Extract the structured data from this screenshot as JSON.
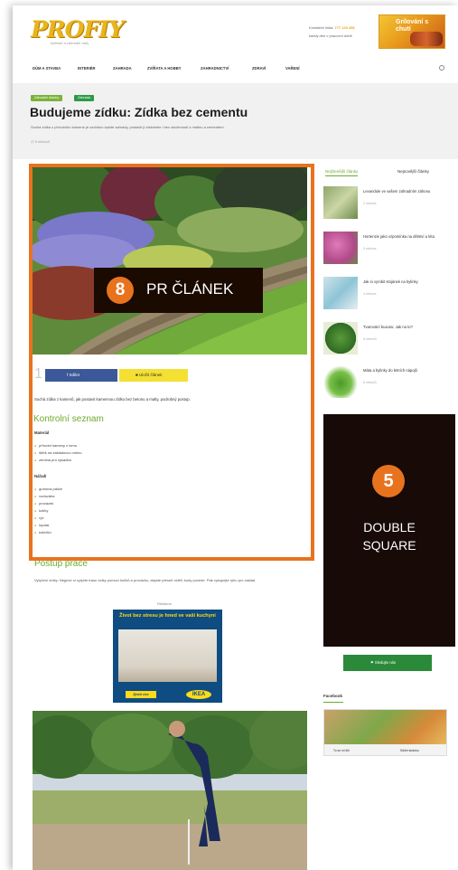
{
  "site": {
    "logo_text": "PROFIY",
    "logo_tagline": "kutilské a zahradní rady",
    "contact_text": "Kontaktní linka:",
    "contact_phone": "777 123 456",
    "contact_sub": "každý den v pracovní době",
    "header_ad_text": "Grilování s chutí"
  },
  "nav": {
    "items": [
      "DŮM A STAVBA",
      "INTERIÉR",
      "ZAHRADA",
      "ZVÍŘATA A HOBBY",
      "ZAHRADNICTVÍ",
      "ZDRAVÍ",
      "VAŘENÍ"
    ]
  },
  "article": {
    "categories": [
      "Zahradní stavby",
      "Zahrada"
    ],
    "title": "Budujeme zídku: Zídka bez cementu",
    "lead": "Suchá zídka z přírodního kamene je ozdobou každé zahrady, postavit ji zvládnete i bez zkušeností s maltou a cementem.",
    "date": "5 měsíců",
    "share_count": "1",
    "fb_label": "Sdílet",
    "save_label": "Uložit článek",
    "intro": "Suchá zídka z kamenů, jak postavit kamennou zídku bez betonu a malty, podrobný postup.",
    "checklist_title": "Kontrolní seznam",
    "materials_title": "Materiál",
    "materials": [
      "přírodní kameny z lomu",
      "štěrk na základovou vrstvu",
      "zemina pro výsadbu"
    ],
    "tools_title": "Nářadí",
    "tools": [
      "gumová palice",
      "vodováha",
      "provázek",
      "kolíky",
      "rýč",
      "lopata",
      "kolečko"
    ],
    "procedure_title": "Postup práce",
    "procedure_text": "Vytyčení zídky: Nejprve si vytyčte trasu zídky pomocí kolíků a provázku, abyste přesně viděli, kudy povede. Pak vykopejte rýhu pro základ."
  },
  "ad": {
    "label": "Reklama",
    "headline": "Život bez stresu je hned ve vaší kuchyni",
    "cta": "Zjistit více",
    "brand": "IKEA"
  },
  "overlay": {
    "article_number": "8",
    "article_label": "PR ČLÁNEK",
    "square_number": "5",
    "square_line1": "DOUBLE",
    "square_line2": "SQUARE"
  },
  "sidebar": {
    "tab_active": "Nejčtenější články",
    "tab_other": "Nejnovější články",
    "items": [
      {
        "title": "Levandule ve vašem zahradním záhonu",
        "date": "2 měsíce"
      },
      {
        "title": "Hortenzie jako vzpomínka na dětství a léta",
        "date": "3 měsíce"
      },
      {
        "title": "Jak si vyrobit stojánek na bylinky",
        "date": "4 měsíce"
      },
      {
        "title": "Tvarování buxusu: Jak na to?",
        "date": "5 měsíců"
      },
      {
        "title": "Máta a bylinky do letních nápojů",
        "date": "6 měsíců"
      }
    ],
    "follow_label": "Sledujte nás",
    "facebook_title": "Facebook",
    "fb_like": "To se mi líbí",
    "fb_share": "Sdílet stránku"
  },
  "colors": {
    "accent_orange": "#e8731f",
    "green": "#6caa2c",
    "dark_panel": "#180a06"
  }
}
